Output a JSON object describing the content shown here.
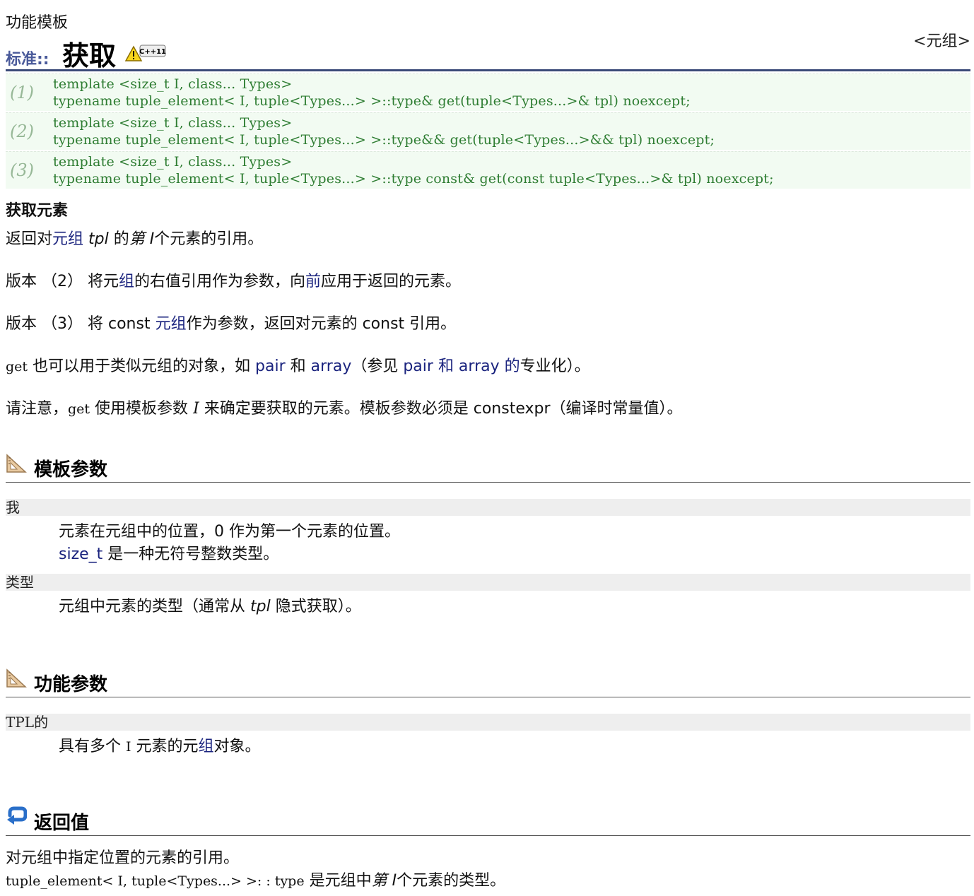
{
  "header": {
    "kicker": "功能模板",
    "header_file": "<元组>",
    "namespace": "标准::",
    "function_name": "获取",
    "badge_text": "C++11"
  },
  "declarations": [
    {
      "num": "(1)",
      "line1": "template <size_t I, class... Types>",
      "line2": "typename tuple_element< I, tuple<Types...> >::type& get(tuple<Types...>& tpl) noexcept;"
    },
    {
      "num": "(2)",
      "line1": "template <size_t I, class... Types>",
      "line2": "typename tuple_element< I, tuple<Types...> >::type&& get(tuple<Types...>&& tpl) noexcept;"
    },
    {
      "num": "(3)",
      "line1": "template <size_t I, class... Types>",
      "line2": "typename tuple_element< I, tuple<Types...> >::type const& get(const tuple<Types...>& tpl) noexcept;"
    }
  ],
  "desc": {
    "heading": "获取元素",
    "p1": {
      "a": "返回对",
      "link": "元组",
      "b": " ",
      "tpl": "tpl",
      "c": " 的",
      "nth": "第 I",
      "d": "个元素的引用。"
    },
    "p2": {
      "a": "版本 （2） 将元",
      "link1": "组",
      "b": "的右值引用作为参数，向",
      "link2": "前",
      "c": "应用于返回的元素。"
    },
    "p3": {
      "a": "版本 （3） 将 const ",
      "link": "元组",
      "b": "作为参数，返回对元素的 const 引用。"
    },
    "p4": {
      "code": "get",
      "a": " 也可以用于类似元组的对象，如 ",
      "link1": "pair",
      "b": " 和 ",
      "link2": "array",
      "c": "（参见 ",
      "link3": "pair 和 array 的",
      "d": "专业化）。"
    },
    "p5": {
      "a": "请注意，",
      "code": "get",
      "b": " 使用模板参数 ",
      "i": "I",
      "c": " 来确定要获取的元素。模板参数必须是 constexpr（编译时常量值）。"
    }
  },
  "template_params": {
    "title": "模板参数",
    "icon": "ruler-triangle-icon",
    "items": [
      {
        "term": "我",
        "def1": "元素在元组中的位置，0 作为第一个元素的位置。",
        "def2_link": "size_t",
        "def2_rest": " 是一种无符号整数类型。"
      },
      {
        "term": "类型",
        "def1_a": "元组中元素的类型（通常从 ",
        "def1_tpl": "tpl",
        "def1_b": " 隐式获取）。"
      }
    ]
  },
  "function_params": {
    "title": "功能参数",
    "icon": "ruler-triangle-icon",
    "items": [
      {
        "term": "TPL的",
        "def_a": "具有多个 ",
        "def_i": "I",
        "def_b": " 元素的元",
        "def_link": "组",
        "def_c": "对象。"
      }
    ]
  },
  "return_value": {
    "title": "返回值",
    "icon": "return-arrow-icon",
    "line1": "对元组中指定位置的元素的引用。",
    "line2_code": "tuple_element< I, tuple<Types...> >: : type",
    "line2_a": " 是元组中",
    "line2_nth": "第 I",
    "line2_b": "个元素的类型。"
  },
  "colors": {
    "link": "#1a237e",
    "code_green": "#2e7d32",
    "decl_bg": "#f2fbf2",
    "title_rule": "#3a4a78",
    "term_bg": "#eeeeee"
  }
}
